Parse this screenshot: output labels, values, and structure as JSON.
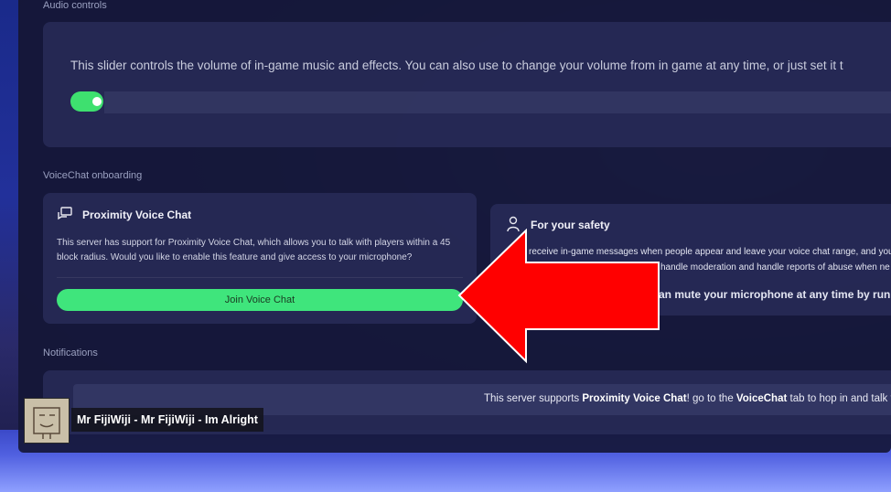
{
  "audio": {
    "section_label": "Audio controls",
    "description": "This slider controls the volume of in-game music and effects. You can also use to change your volume from in game at any time, or just set it t",
    "toggle_state": "on"
  },
  "voicechat": {
    "section_label": "VoiceChat onboarding",
    "proximity": {
      "icon": "chat-bubbles-icon",
      "title": "Proximity Voice Chat",
      "body": "This server has support for Proximity Voice Chat, which allows you to talk with players within a 45 block radius. Would you like to enable this feature and give access to your microphone?",
      "join_label": "Join Voice Chat"
    },
    "safety": {
      "icon": "person-icon",
      "title": "For your safety",
      "line1": "receive in-game messages when people appear and leave your voice chat range, and you'",
      "line2": "handle moderation and handle reports of abuse when ne",
      "line3": "an mute your microphone at any time by runnin"
    }
  },
  "notifications": {
    "section_label": "Notifications",
    "msg_pre": "This server supports ",
    "msg_bold1": "Proximity Voice Chat",
    "msg_mid": "! go to the ",
    "msg_bold2": "VoiceChat",
    "msg_post": " tab to hop in and talk t"
  },
  "now_playing": {
    "track": "Mr FijiWiji - Mr FijiWiji - Im Alright"
  },
  "colors": {
    "accent_green": "#3fe57c",
    "arrow_red": "#ff0000"
  }
}
